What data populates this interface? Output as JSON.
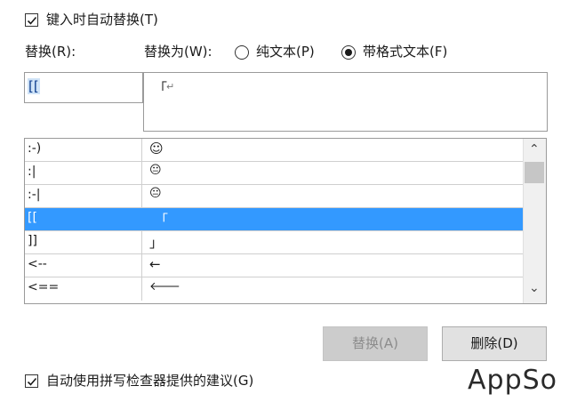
{
  "autoreplace_checkbox": {
    "label": "键入时自动替换(T)",
    "checked": true
  },
  "replace_label": "替换(R):",
  "replace_with_label": "替换为(W):",
  "plain_text_radio": {
    "label": "纯文本(P)",
    "selected": false
  },
  "formatted_text_radio": {
    "label": "带格式文本(F)",
    "selected": true
  },
  "replace_input_value": "[[",
  "replace_with_value": "「",
  "replace_with_mark": "↵",
  "entries": [
    {
      "from": ":-)",
      "to": "☺"
    },
    {
      "from": ":|",
      "to": "😐"
    },
    {
      "from": ":-|",
      "to": "😐"
    },
    {
      "from": "[[",
      "to": "「",
      "selected": true
    },
    {
      "from": "]]",
      "to": "」"
    },
    {
      "from": "<--",
      "to": "←"
    },
    {
      "from": "<==",
      "to": "🡐"
    }
  ],
  "scrollbar": {
    "up": "⌃",
    "down": "⌄"
  },
  "buttons": {
    "replace": "替换(A)",
    "delete": "删除(D)"
  },
  "spell_checkbox": {
    "label": "自动使用拼写检查器提供的建议(G)",
    "checked": true
  },
  "watermark": "AppSo",
  "colors": {
    "selection": "#3399ff",
    "text_highlight": "#cfe3f7"
  }
}
